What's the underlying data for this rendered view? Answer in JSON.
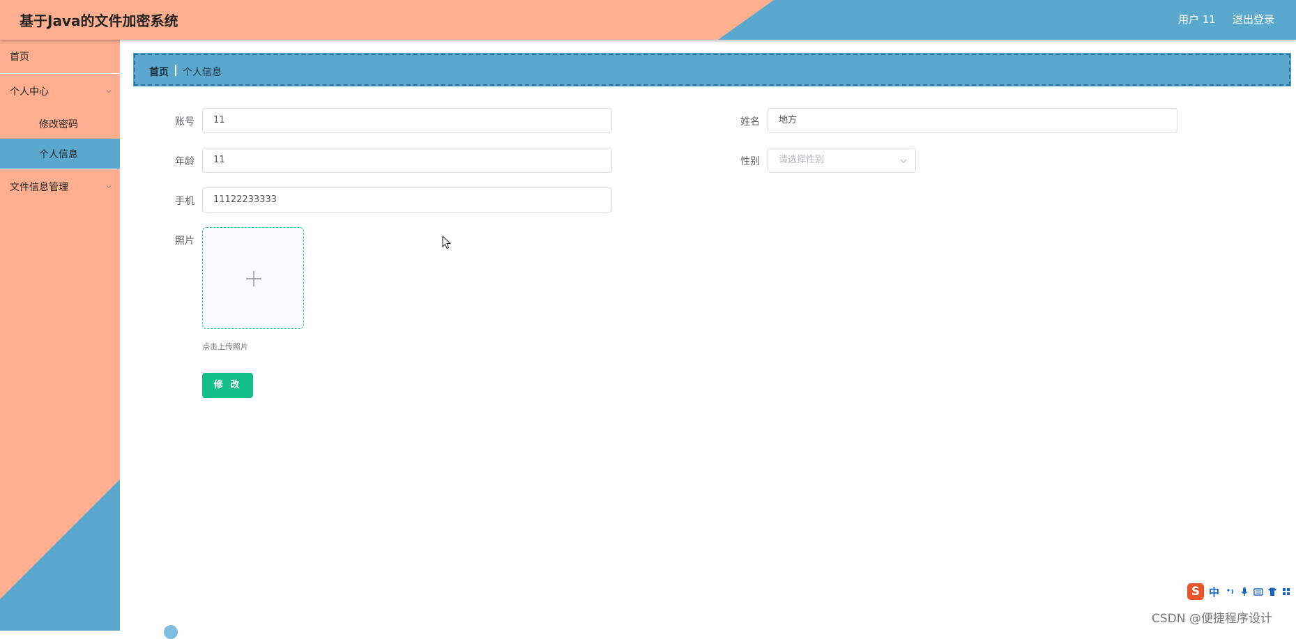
{
  "header": {
    "title": "基于Java的文件加密系统",
    "user_label": "用户 11",
    "logout_label": "退出登录"
  },
  "sidebar": {
    "items": [
      {
        "label": "首页"
      },
      {
        "label": "个人中心"
      },
      {
        "label": "修改密码"
      },
      {
        "label": "个人信息"
      },
      {
        "label": "文件信息管理"
      }
    ]
  },
  "breadcrumb": {
    "home": "首页",
    "current": "个人信息"
  },
  "form": {
    "account": {
      "label": "账号",
      "value": "11"
    },
    "name": {
      "label": "姓名",
      "value": "地方"
    },
    "age": {
      "label": "年龄",
      "value": "11"
    },
    "gender": {
      "label": "性别",
      "placeholder": "请选择性别"
    },
    "phone": {
      "label": "手机",
      "value": "11122233333"
    },
    "photo": {
      "label": "照片",
      "hint": "点击上传照片"
    },
    "submit_label": "修 改"
  },
  "ime": {
    "logo": "S",
    "mode": "中"
  },
  "watermark": "CSDN @便捷程序设计",
  "colors": {
    "salmon": "#ffaf8f",
    "blue": "#5ba8cf",
    "primary_button": "#13bf86",
    "upload_border": "#2fbf88"
  },
  "icons": [
    "chevron-down-icon",
    "plus-icon",
    "mouse-cursor-icon",
    "ime-logo-icon",
    "microphone-icon",
    "keyboard-icon",
    "shirt-icon"
  ]
}
